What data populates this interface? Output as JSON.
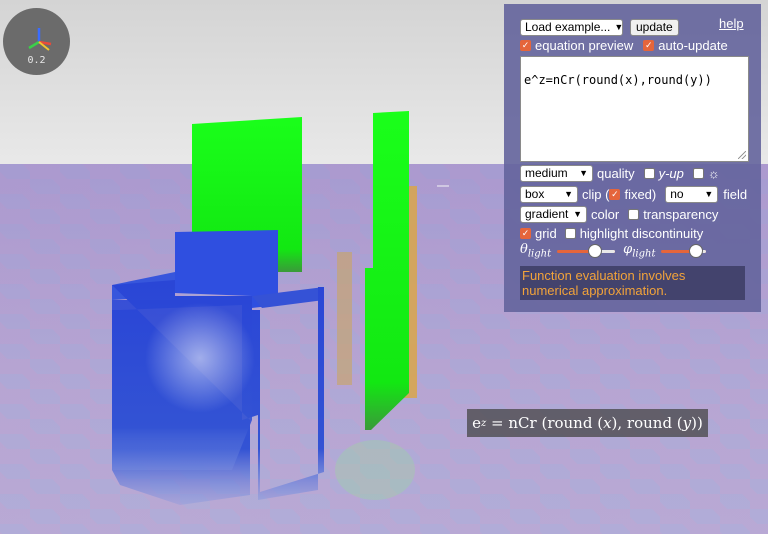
{
  "gizmo": {
    "scale_label": "0.2"
  },
  "toolbar": {
    "examples_select": "Load example...",
    "update_label": "update",
    "help_label": "help",
    "equation_preview_label": "equation preview",
    "equation_preview_checked": true,
    "auto_update_label": "auto-update",
    "auto_update_checked": true
  },
  "editor": {
    "value": "e^z=nCr(round(x),round(y))"
  },
  "options": {
    "quality_value": "medium",
    "quality_label": "quality",
    "y_up_label": "y-up",
    "y_up_checked": false,
    "light_symbol": "☼",
    "light_checked": false,
    "clip_value": "box",
    "clip_label": "clip (",
    "fixed_label": "fixed)",
    "fixed_checked": true,
    "field_value": "no",
    "field_label": "field",
    "color_value": "gradient",
    "color_label": "color",
    "transparency_label": "transparency",
    "transparency_checked": false,
    "grid_label": "grid",
    "grid_checked": true,
    "discontinuity_label": "highlight discontinuity",
    "discontinuity_checked": false,
    "theta_symbol": "θ",
    "phi_symbol": "φ",
    "light_sub": "light",
    "theta_value": 0.7,
    "phi_value": 0.9
  },
  "notice": {
    "text": "Function evaluation involves numerical approximation."
  },
  "equation_overlay": {
    "base": "e",
    "exponent": "z",
    "rhs": " = nCr (round (",
    "x": "x",
    "mid": "), round (",
    "y": "y",
    "end": "))"
  },
  "colors": {
    "accent": "#e5653b",
    "panel": "#64649c",
    "notice_text": "#f2a33a",
    "surface_green": "#00ff00",
    "surface_blue": "#2a46d6"
  }
}
